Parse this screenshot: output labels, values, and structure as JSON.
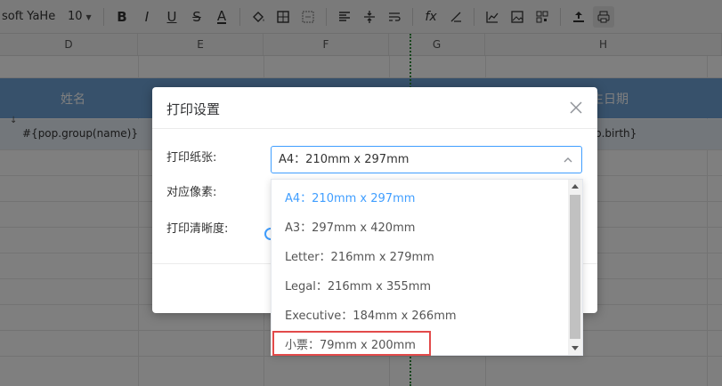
{
  "toolbar": {
    "font_name": "soft YaHei",
    "font_size": "10",
    "buttons": [
      "bold-icon",
      "italic-icon",
      "underline-icon",
      "strikethrough-icon",
      "text-color-icon",
      "fill-color-icon",
      "border-icon",
      "merge-icon",
      "align-icon",
      "valign-icon",
      "wrap-icon",
      "function-icon",
      "clear-icon",
      "chart-icon",
      "image-icon",
      "qrcode-icon",
      "upload-icon",
      "print-icon"
    ]
  },
  "columns": [
    "D",
    "E",
    "F",
    "G",
    "H"
  ],
  "sheet": {
    "header_left": "姓名",
    "header_right": "生日期",
    "cell_left": "#{pop.group(name)}",
    "cell_right": "p.birth}"
  },
  "dialog": {
    "title": "打印设置",
    "paper_label": "打印纸张:",
    "pixel_label": "对应像素:",
    "clarity_label": "打印清晰度:",
    "selected_value": "A4：210mm x 297mm"
  },
  "dropdown": {
    "options": [
      {
        "label": "A4：210mm x 297mm",
        "selected": true
      },
      {
        "label": "A3：297mm x 420mm",
        "selected": false
      },
      {
        "label": "Letter：216mm x 279mm",
        "selected": false
      },
      {
        "label": "Legal：216mm x 355mm",
        "selected": false
      },
      {
        "label": "Executive：184mm x 266mm",
        "selected": false
      },
      {
        "label": "小票：79mm x 200mm",
        "selected": false
      }
    ]
  },
  "colors": {
    "accent": "#409eff",
    "header_blue": "#6ea2d6",
    "highlight_red": "#e24a4a"
  }
}
